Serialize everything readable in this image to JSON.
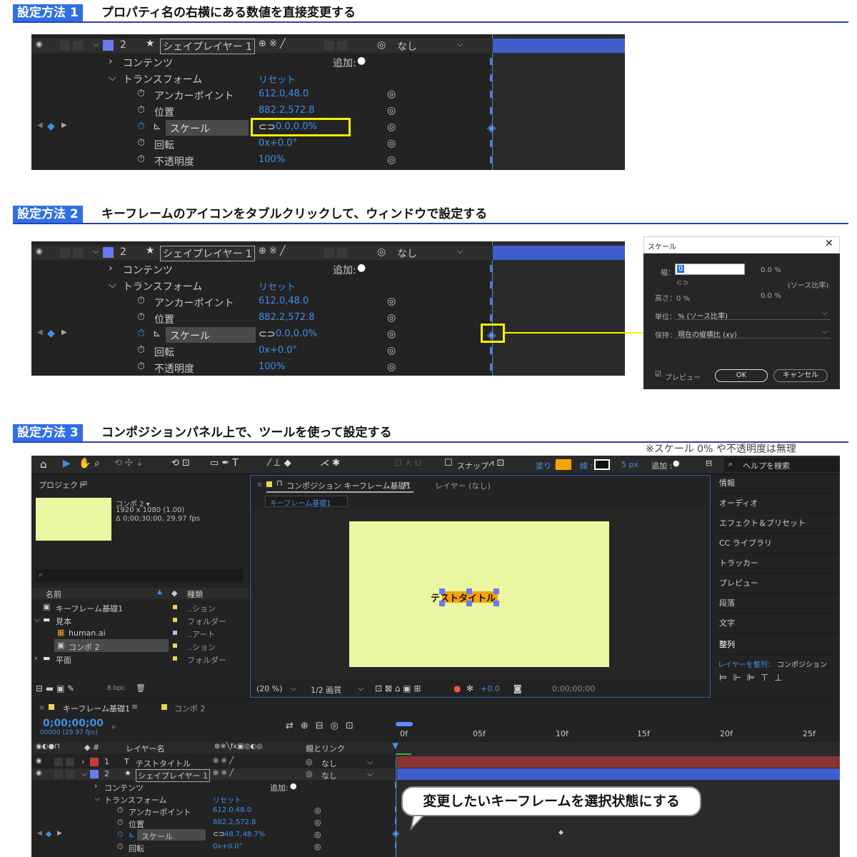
{
  "sections": [
    {
      "badge": "設定方法 1",
      "title": "プロパティ名の右横にある数値を直接変更する"
    },
    {
      "badge": "設定方法 2",
      "title": "キーフレームのアイコンをタブルクリックして、ウィンドウで設定する"
    },
    {
      "badge": "設定方法 3",
      "title": "コンポジションパネル上で、ツールを使って設定する"
    }
  ],
  "note": "※スケール 0% や不透明度は無理",
  "layer_panel": {
    "layer_num": "2",
    "layer_name": "シェイプレイヤー 1",
    "parent_value": "なし",
    "contents": "コンテンツ",
    "add_label": "追加:",
    "transform": "トランスフォーム",
    "reset": "リセット",
    "anchor_label": "アンカーポイント",
    "anchor_value": "612.0,48.0",
    "position_label": "位置",
    "position_value": "882.2,572.8",
    "scale_label": "スケール",
    "scale_value": "0.0,0.0%",
    "rotation_label": "回転",
    "rotation_value": "0x+0.0°",
    "opacity_label": "不透明度",
    "opacity_value": "100%"
  },
  "scale_dialog": {
    "title": "スケール",
    "width_label": "幅：",
    "width_value": "0",
    "width_pct": "0.0 %",
    "source_ratio": "(ソース比率)",
    "height_label": "高さ：0 %",
    "height_pct": "0.0 %",
    "unit_label": "単位：",
    "unit_value": "% (ソース比率)",
    "keep_label": "保持：",
    "keep_value": "現在の縦横比 (xy)",
    "preview": "プレビュー",
    "ok": "OK",
    "cancel": "キャンセル"
  },
  "ae_full": {
    "toolbar": {
      "snap": "スナップ",
      "fill": "塗り :",
      "stroke": "線 :",
      "stroke_px": "5 px",
      "add": "追加 :",
      "search": "ヘルプを検索"
    },
    "project": {
      "title": "プロジェクト",
      "comp_name": "コンポ 2 ▾",
      "comp_res": "1920 x 1080 (1.00)",
      "comp_dur": "Δ 0;00;30;00, 29.97 fps",
      "col_name": "名前",
      "col_type": "種類",
      "items": [
        {
          "name": "キーフレーム基礎1",
          "type": "..ション"
        },
        {
          "name": "見本",
          "type": "フォルダー"
        },
        {
          "name": "human.ai",
          "type": "..アート"
        },
        {
          "name": "コンポ 2",
          "type": "..ション"
        },
        {
          "name": "平面",
          "type": "フォルダー"
        }
      ],
      "bpc": "8 bpc"
    },
    "comp_panel": {
      "tab": "コンポジション キーフレーム基礎1",
      "layer_tab": "レイヤー (なし)",
      "sub_tab": "キーフレーム基礎1",
      "zoom": "(20 %)",
      "quality": "1/2 画質",
      "exposure": "+0.0",
      "time": "0;00;00;00",
      "title_text": "テストタイトル"
    },
    "right_panel": [
      "情報",
      "オーディオ",
      "エフェクト＆プリセット",
      "CC ライブラリ",
      "トラッカー",
      "プレビュー",
      "段落",
      "文字",
      "整列"
    ],
    "align_label": "レイヤーを整列：",
    "align_value": "コンポジション",
    "timeline": {
      "tab1": "キーフレーム基礎1",
      "tab2": "コンポ 2",
      "timecode": "0;00;00;00",
      "frames": "00000 (29.97 fps)",
      "col_layer": "レイヤー名",
      "col_parent": "親とリンク",
      "ticks": [
        "0f",
        "05f",
        "10f",
        "15f",
        "20f",
        "25f"
      ],
      "layers": [
        {
          "num": "1",
          "name": "テストタイトル",
          "parent": "なし"
        },
        {
          "num": "2",
          "name": "シェイプレイヤー 1",
          "parent": "なし"
        }
      ],
      "scale_value": "48.7,48.7%"
    },
    "callout": "変更したいキーフレームを選択状態にする"
  }
}
